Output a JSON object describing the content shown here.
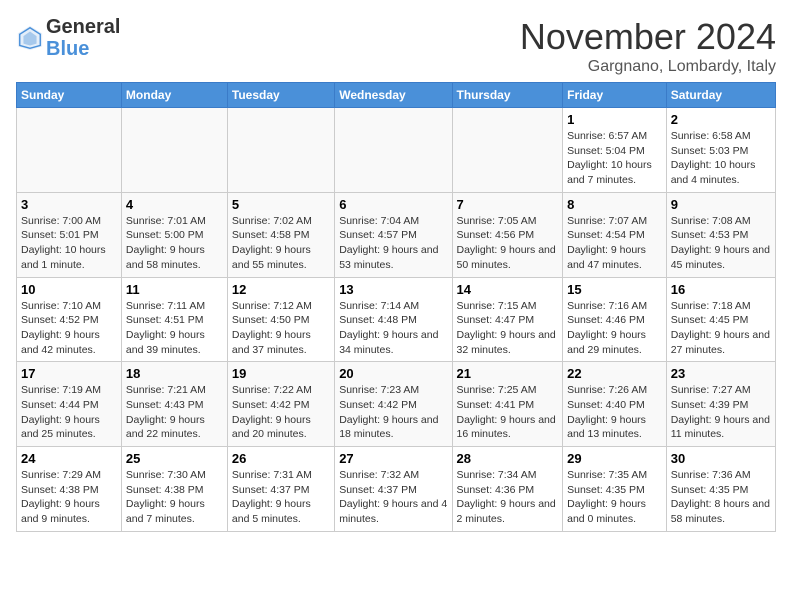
{
  "header": {
    "logo_general": "General",
    "logo_blue": "Blue",
    "title": "November 2024",
    "location": "Gargnano, Lombardy, Italy"
  },
  "days_of_week": [
    "Sunday",
    "Monday",
    "Tuesday",
    "Wednesday",
    "Thursday",
    "Friday",
    "Saturday"
  ],
  "weeks": [
    [
      {
        "day": "",
        "info": "",
        "empty": true
      },
      {
        "day": "",
        "info": "",
        "empty": true
      },
      {
        "day": "",
        "info": "",
        "empty": true
      },
      {
        "day": "",
        "info": "",
        "empty": true
      },
      {
        "day": "",
        "info": "",
        "empty": true
      },
      {
        "day": "1",
        "info": "Sunrise: 6:57 AM\nSunset: 5:04 PM\nDaylight: 10 hours and 7 minutes."
      },
      {
        "day": "2",
        "info": "Sunrise: 6:58 AM\nSunset: 5:03 PM\nDaylight: 10 hours and 4 minutes."
      }
    ],
    [
      {
        "day": "3",
        "info": "Sunrise: 7:00 AM\nSunset: 5:01 PM\nDaylight: 10 hours and 1 minute."
      },
      {
        "day": "4",
        "info": "Sunrise: 7:01 AM\nSunset: 5:00 PM\nDaylight: 9 hours and 58 minutes."
      },
      {
        "day": "5",
        "info": "Sunrise: 7:02 AM\nSunset: 4:58 PM\nDaylight: 9 hours and 55 minutes."
      },
      {
        "day": "6",
        "info": "Sunrise: 7:04 AM\nSunset: 4:57 PM\nDaylight: 9 hours and 53 minutes."
      },
      {
        "day": "7",
        "info": "Sunrise: 7:05 AM\nSunset: 4:56 PM\nDaylight: 9 hours and 50 minutes."
      },
      {
        "day": "8",
        "info": "Sunrise: 7:07 AM\nSunset: 4:54 PM\nDaylight: 9 hours and 47 minutes."
      },
      {
        "day": "9",
        "info": "Sunrise: 7:08 AM\nSunset: 4:53 PM\nDaylight: 9 hours and 45 minutes."
      }
    ],
    [
      {
        "day": "10",
        "info": "Sunrise: 7:10 AM\nSunset: 4:52 PM\nDaylight: 9 hours and 42 minutes."
      },
      {
        "day": "11",
        "info": "Sunrise: 7:11 AM\nSunset: 4:51 PM\nDaylight: 9 hours and 39 minutes."
      },
      {
        "day": "12",
        "info": "Sunrise: 7:12 AM\nSunset: 4:50 PM\nDaylight: 9 hours and 37 minutes."
      },
      {
        "day": "13",
        "info": "Sunrise: 7:14 AM\nSunset: 4:48 PM\nDaylight: 9 hours and 34 minutes."
      },
      {
        "day": "14",
        "info": "Sunrise: 7:15 AM\nSunset: 4:47 PM\nDaylight: 9 hours and 32 minutes."
      },
      {
        "day": "15",
        "info": "Sunrise: 7:16 AM\nSunset: 4:46 PM\nDaylight: 9 hours and 29 minutes."
      },
      {
        "day": "16",
        "info": "Sunrise: 7:18 AM\nSunset: 4:45 PM\nDaylight: 9 hours and 27 minutes."
      }
    ],
    [
      {
        "day": "17",
        "info": "Sunrise: 7:19 AM\nSunset: 4:44 PM\nDaylight: 9 hours and 25 minutes."
      },
      {
        "day": "18",
        "info": "Sunrise: 7:21 AM\nSunset: 4:43 PM\nDaylight: 9 hours and 22 minutes."
      },
      {
        "day": "19",
        "info": "Sunrise: 7:22 AM\nSunset: 4:42 PM\nDaylight: 9 hours and 20 minutes."
      },
      {
        "day": "20",
        "info": "Sunrise: 7:23 AM\nSunset: 4:42 PM\nDaylight: 9 hours and 18 minutes."
      },
      {
        "day": "21",
        "info": "Sunrise: 7:25 AM\nSunset: 4:41 PM\nDaylight: 9 hours and 16 minutes."
      },
      {
        "day": "22",
        "info": "Sunrise: 7:26 AM\nSunset: 4:40 PM\nDaylight: 9 hours and 13 minutes."
      },
      {
        "day": "23",
        "info": "Sunrise: 7:27 AM\nSunset: 4:39 PM\nDaylight: 9 hours and 11 minutes."
      }
    ],
    [
      {
        "day": "24",
        "info": "Sunrise: 7:29 AM\nSunset: 4:38 PM\nDaylight: 9 hours and 9 minutes."
      },
      {
        "day": "25",
        "info": "Sunrise: 7:30 AM\nSunset: 4:38 PM\nDaylight: 9 hours and 7 minutes."
      },
      {
        "day": "26",
        "info": "Sunrise: 7:31 AM\nSunset: 4:37 PM\nDaylight: 9 hours and 5 minutes."
      },
      {
        "day": "27",
        "info": "Sunrise: 7:32 AM\nSunset: 4:37 PM\nDaylight: 9 hours and 4 minutes."
      },
      {
        "day": "28",
        "info": "Sunrise: 7:34 AM\nSunset: 4:36 PM\nDaylight: 9 hours and 2 minutes."
      },
      {
        "day": "29",
        "info": "Sunrise: 7:35 AM\nSunset: 4:35 PM\nDaylight: 9 hours and 0 minutes."
      },
      {
        "day": "30",
        "info": "Sunrise: 7:36 AM\nSunset: 4:35 PM\nDaylight: 8 hours and 58 minutes."
      }
    ]
  ]
}
